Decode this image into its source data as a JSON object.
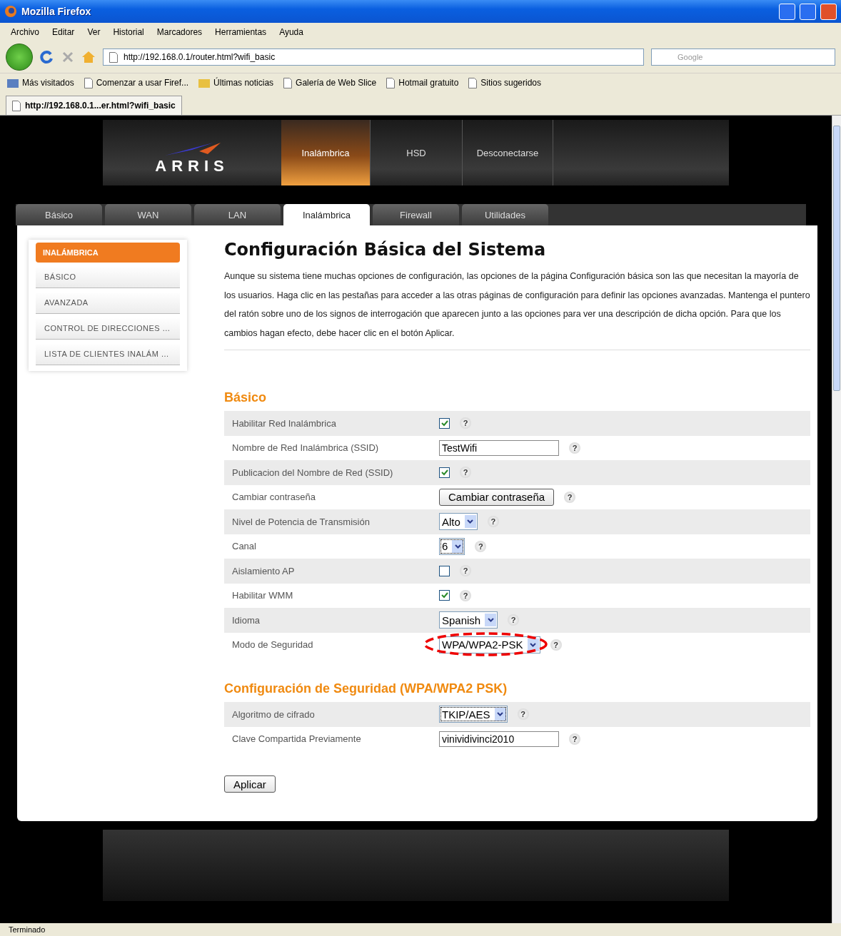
{
  "window": {
    "title": "Mozilla Firefox"
  },
  "menu": [
    "Archivo",
    "Editar",
    "Ver",
    "Historial",
    "Marcadores",
    "Herramientas",
    "Ayuda"
  ],
  "address": {
    "value": "http://192.168.0.1/router.html?wifi_basic"
  },
  "search": {
    "placeholder": "Google"
  },
  "bookmarks": [
    {
      "label": "Más visitados",
      "kind": "folder"
    },
    {
      "label": "Comenzar a usar Firef...",
      "kind": "page"
    },
    {
      "label": "Últimas noticias",
      "kind": "feed"
    },
    {
      "label": "Galería de Web Slice",
      "kind": "page"
    },
    {
      "label": "Hotmail gratuito",
      "kind": "page"
    },
    {
      "label": "Sitios sugeridos",
      "kind": "page"
    }
  ],
  "browser_tab": {
    "title": "http://192.168.0.1...er.html?wifi_basic"
  },
  "router": {
    "logo": "ARRIS",
    "top_nav": [
      {
        "label": "Inalámbrica",
        "selected": true
      },
      {
        "label": "HSD",
        "selected": false
      },
      {
        "label": "Desconectarse",
        "selected": false
      }
    ],
    "tabs": [
      {
        "label": "Básico",
        "selected": false
      },
      {
        "label": "WAN",
        "selected": false
      },
      {
        "label": "LAN",
        "selected": false
      },
      {
        "label": "Inalámbrica",
        "selected": true
      },
      {
        "label": "Firewall",
        "selected": false
      },
      {
        "label": "Utilidades",
        "selected": false
      }
    ],
    "sidebar": {
      "header": "INALÁMBRICA",
      "items": [
        "BÁSICO",
        "AVANZADA",
        "CONTROL DE DIRECCIONES ...",
        "LISTA DE CLIENTES INALÁM ..."
      ]
    },
    "title": "Configuración Básica del Sistema",
    "intro": "Aunque su sistema tiene muchas opciones de configuración, las opciones de la página Configuración básica son las que necesitan la mayoría de los usuarios. Haga clic en las pestañas para acceder a las otras páginas de configuración para definir las opciones avanzadas. Mantenga el puntero del ratón sobre uno de los signos de interrogación que aparecen junto a las opciones para ver una descripción de dicha opción. Para que los cambios hagan efecto, debe hacer clic en el botón Aplicar.",
    "sections": [
      {
        "title": "Básico",
        "rows": [
          {
            "kind": "checkbox",
            "label": "Habilitar Red Inalámbrica",
            "checked": true,
            "help": "?",
            "highlighted": false
          },
          {
            "kind": "text",
            "label": "Nombre de Red Inalámbrica (SSID)",
            "value": "TestWifi",
            "help": "?",
            "highlighted": false
          },
          {
            "kind": "checkbox",
            "label": "Publicacion del Nombre de Red (SSID)",
            "checked": true,
            "help": "?",
            "highlighted": false
          },
          {
            "kind": "button",
            "label": "Cambiar contraseña",
            "button": "Cambiar contraseña",
            "help": "?",
            "highlighted": false
          },
          {
            "kind": "select",
            "label": "Nivel de Potencia de Transmisión",
            "value": "Alto",
            "focused": false,
            "help": "?",
            "highlighted": false
          },
          {
            "kind": "select",
            "label": "Canal",
            "value": "6",
            "focused": true,
            "help": "?",
            "highlighted": false
          },
          {
            "kind": "checkbox",
            "label": "Aislamiento AP",
            "checked": false,
            "help": "?",
            "highlighted": false
          },
          {
            "kind": "checkbox",
            "label": "Habilitar WMM",
            "checked": true,
            "help": "?",
            "highlighted": false
          },
          {
            "kind": "select",
            "label": "Idioma",
            "value": "Spanish",
            "focused": false,
            "help": "?",
            "highlighted": false
          },
          {
            "kind": "select",
            "label": "Modo de Seguridad",
            "value": "WPA/WPA2-PSK",
            "focused": false,
            "help": "?",
            "highlighted": true
          }
        ]
      },
      {
        "title": "Configuración de Seguridad (WPA/WPA2 PSK)",
        "rows": [
          {
            "kind": "select",
            "label": "Algoritmo de cifrado",
            "value": "TKIP/AES",
            "focused": true,
            "help": "?",
            "highlighted": false
          },
          {
            "kind": "text",
            "label": "Clave Compartida Previamente",
            "value": "vinividivinci2010",
            "help": "?",
            "highlighted": false
          }
        ]
      }
    ],
    "apply": "Aplicar"
  },
  "status_bar": "Terminado"
}
